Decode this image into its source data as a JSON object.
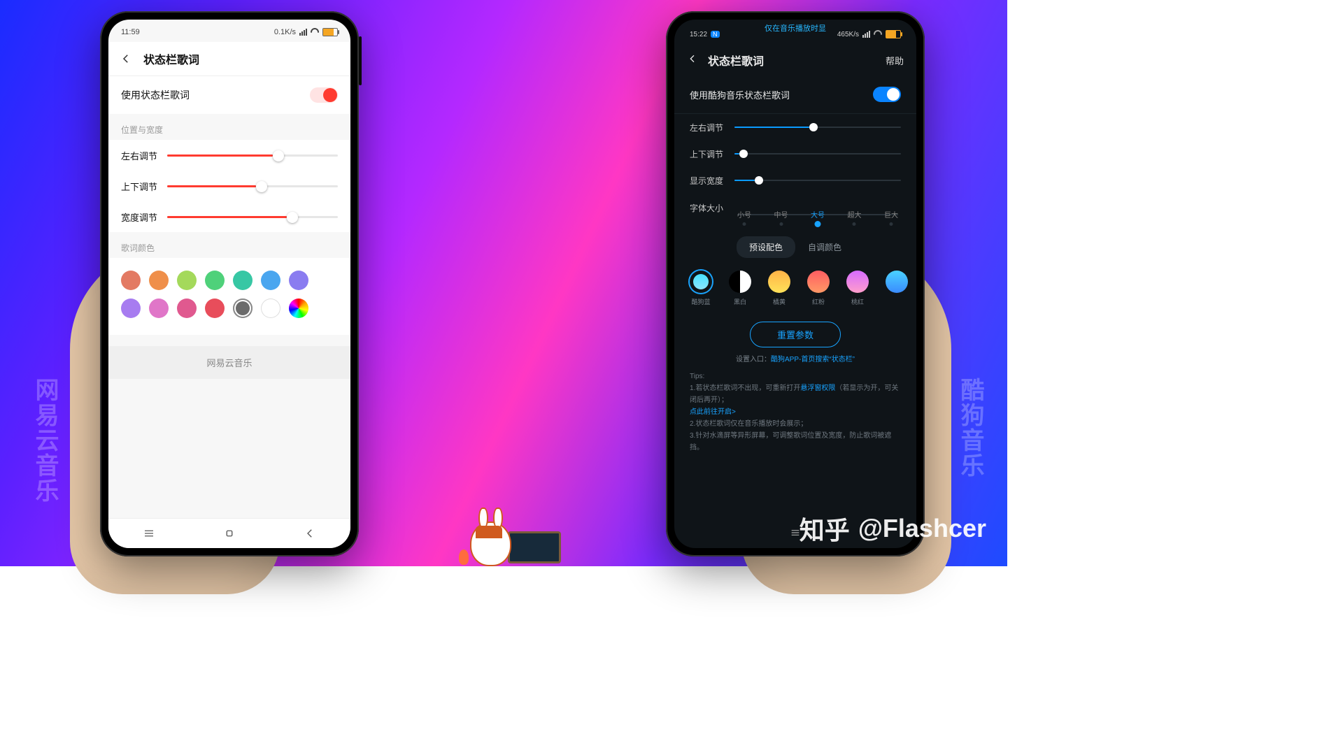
{
  "sideLabels": {
    "left": "网易云音乐",
    "right": "酷狗音乐"
  },
  "watermark": {
    "logo": "知乎",
    "handle": "@Flashcer"
  },
  "left": {
    "status": {
      "time": "11:59",
      "net": "0.1K/s"
    },
    "title": "状态栏歌词",
    "toggle_label": "使用状态栏歌词",
    "section_pos": "位置与宽度",
    "sliders": {
      "h": {
        "label": "左右调节",
        "fill": 62
      },
      "v": {
        "label": "上下调节",
        "fill": 52
      },
      "w": {
        "label": "宽度调节",
        "fill": 70
      }
    },
    "section_color": "歌词颜色",
    "swatches_row1": [
      "#e37a63",
      "#ef8f4a",
      "#a4d95b",
      "#4fd17a",
      "#37c7a4",
      "#4aa6ef",
      "#8a7cf0"
    ],
    "swatches_row2": [
      "#a77cf0",
      "#e076c8",
      "#e0598f",
      "#e84d5b"
    ],
    "footer": "网易云音乐"
  },
  "right": {
    "status": {
      "time": "15:22",
      "net": "465K/s",
      "marquee": "仅在音乐播放时显"
    },
    "title": "状态栏歌词",
    "help": "帮助",
    "toggle_label": "使用酷狗音乐状态栏歌词",
    "sliders": {
      "h": {
        "label": "左右调节",
        "fill": 45
      },
      "v": {
        "label": "上下调节",
        "fill": 3
      },
      "w": {
        "label": "显示宽度",
        "fill": 12
      }
    },
    "font_label": "字体大小",
    "font_steps": [
      "小号",
      "中号",
      "大号",
      "超大",
      "巨大"
    ],
    "font_active": 2,
    "tabs": {
      "preset": "预设配色",
      "custom": "自调颜色"
    },
    "presets": [
      {
        "name": "酷狗蓝",
        "cls": "gr-cy",
        "sel": true
      },
      {
        "name": "黑白",
        "cls": "gr-bw"
      },
      {
        "name": "橘黄",
        "cls": "gr-oy"
      },
      {
        "name": "红粉",
        "cls": "gr-rp"
      },
      {
        "name": "桃红",
        "cls": "gr-pk"
      }
    ],
    "reset": "重置参数",
    "entry_prefix": "设置入口：",
    "entry_link": "酷狗APP-首页搜索“状态栏”",
    "tips_title": "Tips:",
    "tip1a": "1.若状态栏歌词不出现，可重新打开",
    "tip1b": "悬浮窗权限",
    "tip1c": "（若显示为开，可关闭后再开）；",
    "tip_link": "点此前往开启>",
    "tip2": "2.状态栏歌词仅在音乐播放时会展示；",
    "tip3": "3.针对水滴屏等异形屏幕，可调整歌词位置及宽度，防止歌词被遮挡。"
  }
}
